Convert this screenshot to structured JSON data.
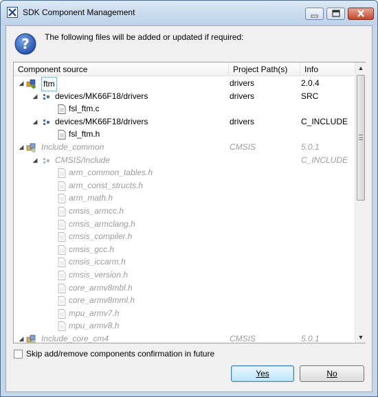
{
  "window": {
    "title": "SDK Component Management"
  },
  "dialog": {
    "message": "The following files will be added or updated if required:"
  },
  "table": {
    "headers": {
      "source": "Component source",
      "path": "Project Path(s)",
      "info": "Info"
    },
    "rows": [
      {
        "level": 0,
        "expander": "◢",
        "icon": "component-icon",
        "name": "ftm",
        "path": "drivers",
        "info": "2.0.4",
        "dim": false,
        "selected": true
      },
      {
        "level": 1,
        "expander": "◢",
        "icon": "folder-group-icon",
        "name": "devices/MK66F18/drivers",
        "path": "drivers",
        "info": "SRC",
        "dim": false
      },
      {
        "level": 2,
        "expander": "",
        "icon": "file-icon",
        "name": "fsl_ftm.c",
        "path": "",
        "info": "",
        "dim": false
      },
      {
        "level": 1,
        "expander": "◢",
        "icon": "folder-group-icon",
        "name": "devices/MK66F18/drivers",
        "path": "drivers",
        "info": "C_INCLUDE",
        "dim": false
      },
      {
        "level": 2,
        "expander": "",
        "icon": "file-icon",
        "name": "fsl_ftm.h",
        "path": "",
        "info": "",
        "dim": false
      },
      {
        "level": 0,
        "expander": "◢",
        "icon": "component-icon",
        "name": "Include_common",
        "path": "CMSIS",
        "info": "5.0.1",
        "dim": true
      },
      {
        "level": 1,
        "expander": "◢",
        "icon": "folder-group-icon",
        "name": "CMSIS/Include",
        "path": "",
        "info": "C_INCLUDE",
        "dim": true
      },
      {
        "level": 2,
        "expander": "",
        "icon": "file-icon",
        "name": "arm_common_tables.h",
        "path": "",
        "info": "",
        "dim": true
      },
      {
        "level": 2,
        "expander": "",
        "icon": "file-icon",
        "name": "arm_const_structs.h",
        "path": "",
        "info": "",
        "dim": true
      },
      {
        "level": 2,
        "expander": "",
        "icon": "file-icon",
        "name": "arm_math.h",
        "path": "",
        "info": "",
        "dim": true
      },
      {
        "level": 2,
        "expander": "",
        "icon": "file-icon",
        "name": "cmsis_armcc.h",
        "path": "",
        "info": "",
        "dim": true
      },
      {
        "level": 2,
        "expander": "",
        "icon": "file-icon",
        "name": "cmsis_armclang.h",
        "path": "",
        "info": "",
        "dim": true
      },
      {
        "level": 2,
        "expander": "",
        "icon": "file-icon",
        "name": "cmsis_compiler.h",
        "path": "",
        "info": "",
        "dim": true
      },
      {
        "level": 2,
        "expander": "",
        "icon": "file-icon",
        "name": "cmsis_gcc.h",
        "path": "",
        "info": "",
        "dim": true
      },
      {
        "level": 2,
        "expander": "",
        "icon": "file-icon",
        "name": "cmsis_iccarm.h",
        "path": "",
        "info": "",
        "dim": true
      },
      {
        "level": 2,
        "expander": "",
        "icon": "file-icon",
        "name": "cmsis_version.h",
        "path": "",
        "info": "",
        "dim": true
      },
      {
        "level": 2,
        "expander": "",
        "icon": "file-icon",
        "name": "core_armv8mbl.h",
        "path": "",
        "info": "",
        "dim": true
      },
      {
        "level": 2,
        "expander": "",
        "icon": "file-icon",
        "name": "core_armv8mml.h",
        "path": "",
        "info": "",
        "dim": true
      },
      {
        "level": 2,
        "expander": "",
        "icon": "file-icon",
        "name": "mpu_armv7.h",
        "path": "",
        "info": "",
        "dim": true
      },
      {
        "level": 2,
        "expander": "",
        "icon": "file-icon",
        "name": "mpu_armv8.h",
        "path": "",
        "info": "",
        "dim": true
      },
      {
        "level": 0,
        "expander": "◢",
        "icon": "component-icon",
        "name": "Include_core_cm4",
        "path": "CMSIS",
        "info": "5.0.1",
        "dim": true
      }
    ]
  },
  "options": {
    "skip_confirmation_label": "Skip add/remove components confirmation in future",
    "skip_confirmation_checked": false
  },
  "buttons": {
    "yes": "Yes",
    "no": "No"
  },
  "colors": {
    "accent": "#3c7fb1",
    "dim_text": "#9c9c9c"
  }
}
